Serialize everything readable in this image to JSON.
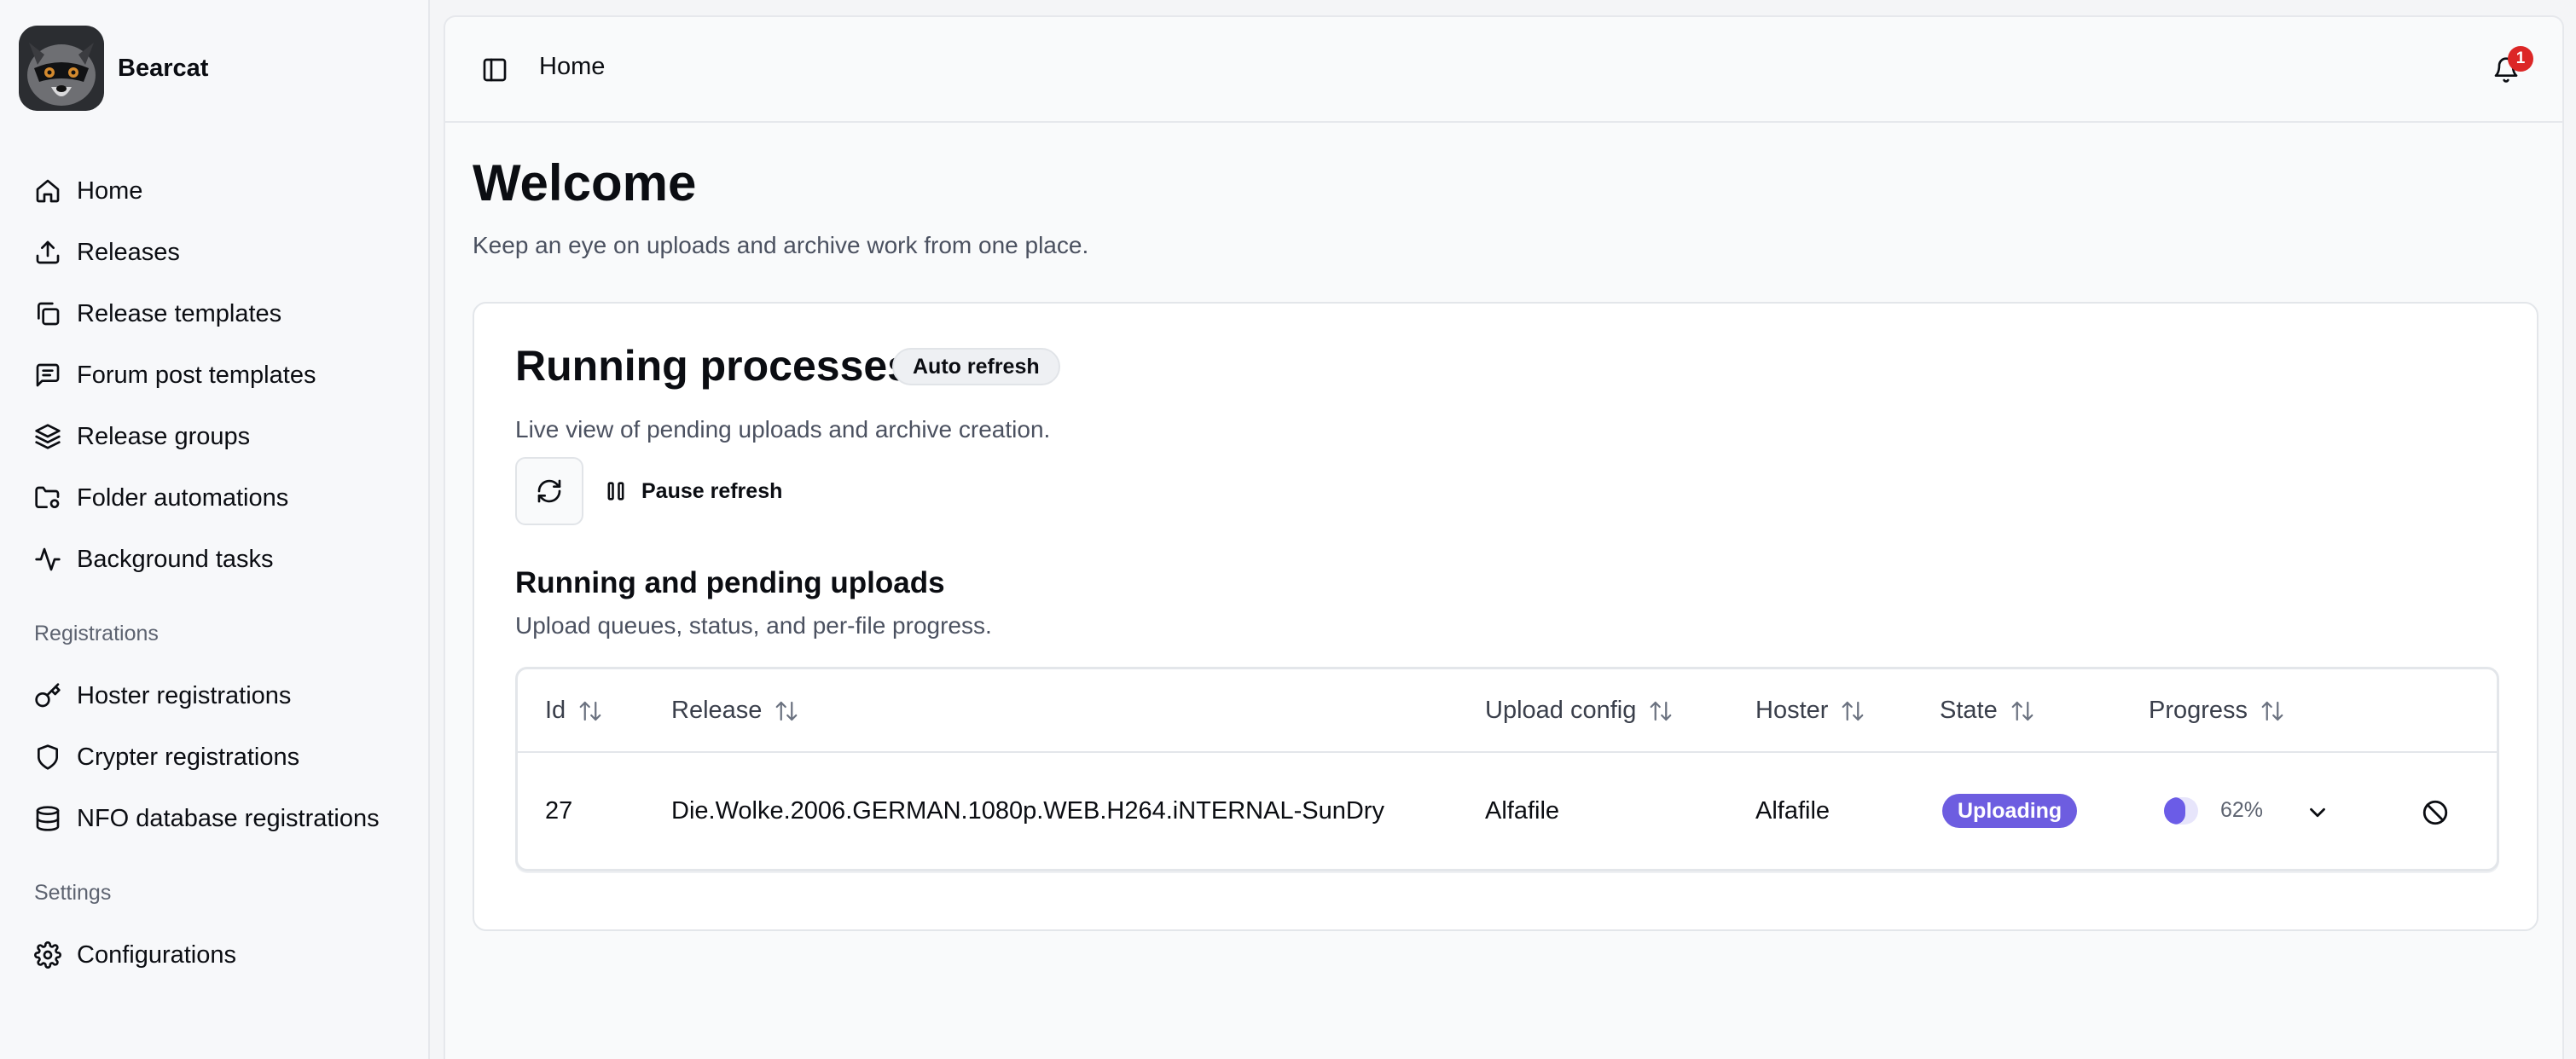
{
  "app": {
    "name": "Bearcat"
  },
  "sidebar": {
    "items": [
      {
        "label": "Home",
        "icon": "home-icon"
      },
      {
        "label": "Releases",
        "icon": "upload-icon"
      },
      {
        "label": "Release templates",
        "icon": "copy-icon"
      },
      {
        "label": "Forum post templates",
        "icon": "message-square-icon"
      },
      {
        "label": "Release groups",
        "icon": "layers-icon"
      },
      {
        "label": "Folder automations",
        "icon": "folder-cog-icon"
      },
      {
        "label": "Background tasks",
        "icon": "activity-icon"
      }
    ],
    "registrations": {
      "title": "Registrations",
      "items": [
        {
          "label": "Hoster registrations",
          "icon": "key-icon"
        },
        {
          "label": "Crypter registrations",
          "icon": "shield-icon"
        },
        {
          "label": "NFO database registrations",
          "icon": "database-icon"
        }
      ]
    },
    "settings": {
      "title": "Settings",
      "items": [
        {
          "label": "Configurations",
          "icon": "gear-icon"
        }
      ]
    }
  },
  "topbar": {
    "title": "Home",
    "notification_count": "1"
  },
  "page": {
    "title": "Welcome",
    "subtitle": "Keep an eye on uploads and archive work from one place."
  },
  "processes": {
    "title": "Running processes",
    "badge": "Auto refresh",
    "subtitle": "Live view of pending uploads and archive creation.",
    "pause_label": "Pause refresh"
  },
  "uploads": {
    "title": "Running and pending uploads",
    "subtitle": "Upload queues, status, and per-file progress.",
    "columns": [
      "Id",
      "Release",
      "Upload config",
      "Hoster",
      "State",
      "Progress"
    ],
    "rows": [
      {
        "id": "27",
        "release": "Die.Wolke.2006.GERMAN.1080p.WEB.H264.iNTERNAL-SunDry",
        "upload_config": "Alfafile",
        "hoster": "Alfafile",
        "state": "Uploading",
        "progress": 0.62,
        "progress_label": "62%"
      }
    ]
  },
  "colors": {
    "accent": "#6b5ce7",
    "badge_red": "#dc2626"
  }
}
